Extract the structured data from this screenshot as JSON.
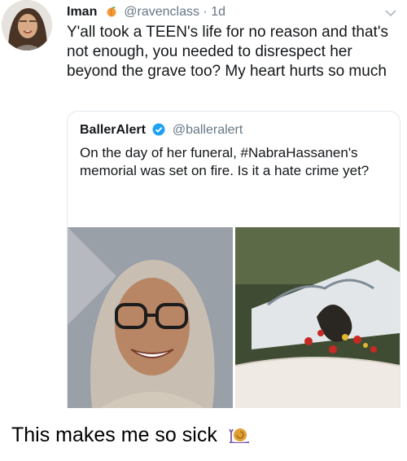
{
  "tweet": {
    "author_name": "Iman",
    "author_handle": "@ravenclass",
    "timestamp": "1d",
    "text": "Y'all took a TEEN's life for no reason and that's not enough, you needed to disrespect her beyond the grave too? My heart hurts so much",
    "name_icon": "peach-emoji",
    "menu_icon": "chevron-down-icon"
  },
  "quoted_tweet": {
    "author_name": "BallerAlert",
    "author_handle": "@balleralert",
    "verified_icon": "verified-badge-icon",
    "text": "On the day of her funeral, #NabraHassanen's memorial was set on fire. Is it a hate crime yet?"
  },
  "caption": {
    "text": "This makes me so sick",
    "emoji": "snail-emoji"
  },
  "colors": {
    "text": "#14171a",
    "secondary": "#657786",
    "border": "#e1e8ed",
    "verified": "#1da1f2"
  }
}
